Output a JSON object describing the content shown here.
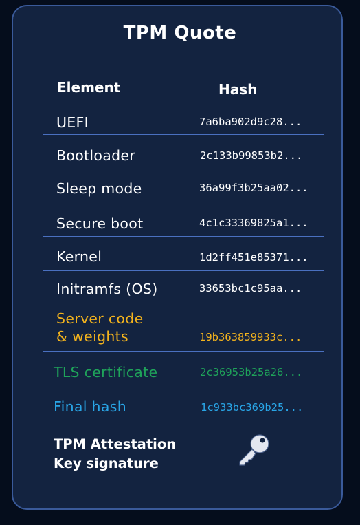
{
  "title": "TPM Quote",
  "headers": {
    "element": "Element",
    "hash": "Hash"
  },
  "rows": [
    {
      "element": "UEFI",
      "hash": "7a6ba902d9c28..."
    },
    {
      "element": "Bootloader",
      "hash": "2c133b99853b2..."
    },
    {
      "element": "Sleep mode",
      "hash": "36a99f3b25aa02..."
    },
    {
      "element": "Secure boot",
      "hash": "4c1c33369825a1..."
    },
    {
      "element": "Kernel",
      "hash": "1d2ff451e85371..."
    },
    {
      "element": "Initramfs (OS)",
      "hash": "33653bc1c95aa..."
    },
    {
      "element_line1": "Server code",
      "element_line2": "& weights",
      "hash": "19b363859933c..."
    },
    {
      "element": "TLS certificate",
      "hash": "2c36953b25a26..."
    },
    {
      "element": "Final hash",
      "hash": "1c933bc369b25..."
    }
  ],
  "signature": {
    "line1": "TPM Attestation",
    "line2": "Key signature",
    "icon": "key-icon"
  },
  "colors": {
    "background": "#050d1c",
    "card": "#132340",
    "border": "#3a5a9a",
    "grid": "#4a70c0",
    "server_code": "#f3b31d",
    "tls": "#1fa35a",
    "final_hash": "#29a5e6"
  }
}
